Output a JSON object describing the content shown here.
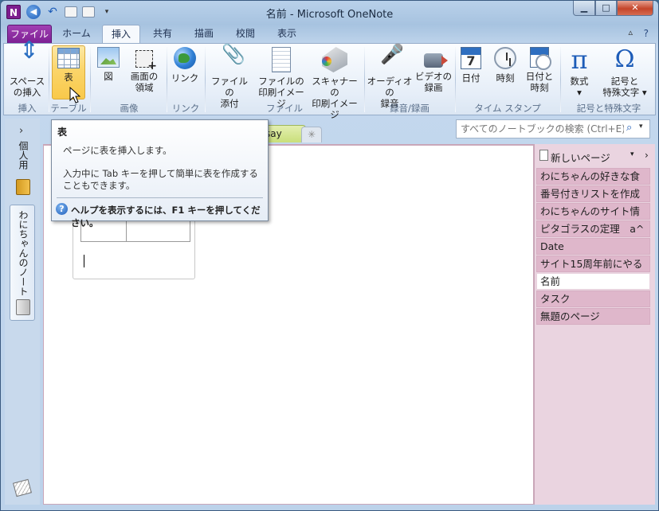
{
  "window": {
    "title": "名前 - Microsoft OneNote",
    "app_logo": "N",
    "qat": {
      "back_glyph": "◀",
      "undo_glyph": "↶",
      "more_glyph": "▾"
    },
    "controls": {
      "minimize": "▁",
      "maximize": "□",
      "close": "✕"
    }
  },
  "ribbon": {
    "tabs": [
      {
        "label": "ファイル"
      },
      {
        "label": "ホーム"
      },
      {
        "label": "挿入"
      },
      {
        "label": "共有"
      },
      {
        "label": "描画"
      },
      {
        "label": "校閲"
      },
      {
        "label": "表示"
      }
    ],
    "active_tab": "挿入",
    "collapse_glyph": "▵",
    "help_glyph": "?",
    "groups": [
      {
        "label": "挿入",
        "buttons": [
          {
            "label1": "スペース",
            "label2": "の挿入",
            "icon": "insert-space-icon"
          }
        ]
      },
      {
        "label": "テーブル",
        "buttons": [
          {
            "label1": "表",
            "icon": "table-icon"
          }
        ]
      },
      {
        "label": "画像",
        "buttons": [
          {
            "label1": "図",
            "icon": "picture-icon"
          },
          {
            "label1": "画面の",
            "label2": "領域",
            "icon": "screen-clipping-icon"
          }
        ]
      },
      {
        "label": "リンク",
        "buttons": [
          {
            "label1": "リンク",
            "icon": "link-icon"
          }
        ]
      },
      {
        "label": "ファイル",
        "buttons": [
          {
            "label1": "ファイルの",
            "label2": "添付",
            "icon": "attach-file-icon"
          },
          {
            "label1": "ファイルの",
            "label2": "印刷イメージ",
            "icon": "file-printout-icon"
          },
          {
            "label1": "スキャナーの",
            "label2": "印刷イメージ",
            "icon": "scanner-printout-icon"
          }
        ]
      },
      {
        "label": "録音/録画",
        "buttons": [
          {
            "label1": "オーディオの",
            "label2": "録音",
            "icon": "microphone-icon"
          },
          {
            "label1": "ビデオの",
            "label2": "録画",
            "icon": "video-camera-icon"
          }
        ]
      },
      {
        "label": "タイム スタンプ",
        "buttons": [
          {
            "label1": "日付",
            "icon": "calendar-icon"
          },
          {
            "label1": "時刻",
            "icon": "clock-icon"
          },
          {
            "label1": "日付と",
            "label2": "時刻",
            "icon": "date-time-icon"
          }
        ]
      },
      {
        "label": "記号と特殊文字",
        "buttons": [
          {
            "label1": "数式",
            "label2": "▾",
            "icon": "pi-equation-icon",
            "glyph": "π"
          },
          {
            "label1": "記号と",
            "label2": "特殊文字 ▾",
            "icon": "omega-symbol-icon",
            "glyph": "Ω"
          }
        ]
      }
    ]
  },
  "notebooks": {
    "expand_glyph": "›",
    "items": [
      {
        "label": "個人用"
      },
      {
        "label": "わにちゃんのノート"
      }
    ]
  },
  "sections": {
    "visible_tab": "say",
    "new_tab_glyph": "✳"
  },
  "search": {
    "placeholder": "すべてのノートブックの検索 (Ctrl+E)",
    "icon_glyph": "⌕",
    "dropdown_glyph": "▾"
  },
  "pages": {
    "new_page_label": "新しいページ",
    "dropdown_glyph": "▾",
    "expand_glyph": "›",
    "items": [
      {
        "label": "わにちゃんの好きな食"
      },
      {
        "label": "番号付きリストを作成"
      },
      {
        "label": "わにちゃんのサイト情"
      },
      {
        "label": "ピタゴラスの定理　a^"
      },
      {
        "label": "Date"
      },
      {
        "label": "サイト15周年前にやる"
      },
      {
        "label": "名前",
        "active": true
      },
      {
        "label": "タスク"
      },
      {
        "label": "無題のページ"
      }
    ]
  },
  "tooltip": {
    "title": "表",
    "description": "ページに表を挿入します。",
    "detail": "入力中に Tab キーを押して簡単に表を作成することもできます。",
    "help_text": "ヘルプを表示するには、F1 キーを押してください。",
    "help_glyph": "?"
  },
  "colors": {
    "file_tab": "#7b1f92",
    "section_color": "#ead4e0",
    "highlight": "#fbd56a"
  }
}
